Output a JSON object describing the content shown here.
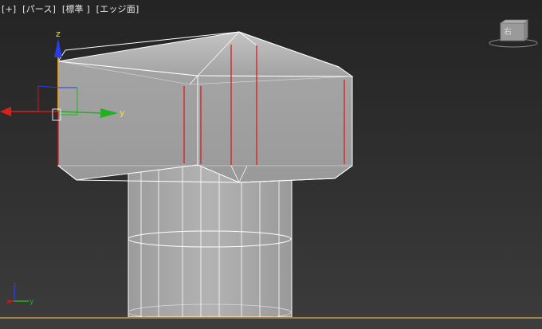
{
  "viewport": {
    "labels": [
      "[+]",
      "[パース]",
      "[標準 ]",
      "[エッジ面]"
    ],
    "view_cube_label": "右"
  },
  "gizmo": {
    "z_label": "z",
    "y_label": "y"
  },
  "axis_tripod": {
    "z_label": "z",
    "x_label": "x",
    "y_label": "y"
  },
  "colors": {
    "background_top": "#242424",
    "background_bottom": "#3c3c3c",
    "mesh_fill": "#a9a9a9",
    "mesh_wire": "#ffffff",
    "selected_edge": "#d81e1e",
    "axis_x": "#e01c1c",
    "axis_y": "#22b022",
    "axis_z": "#2a3de8",
    "label_yellow": "#f0e040",
    "ground_line": "#a7844a"
  }
}
